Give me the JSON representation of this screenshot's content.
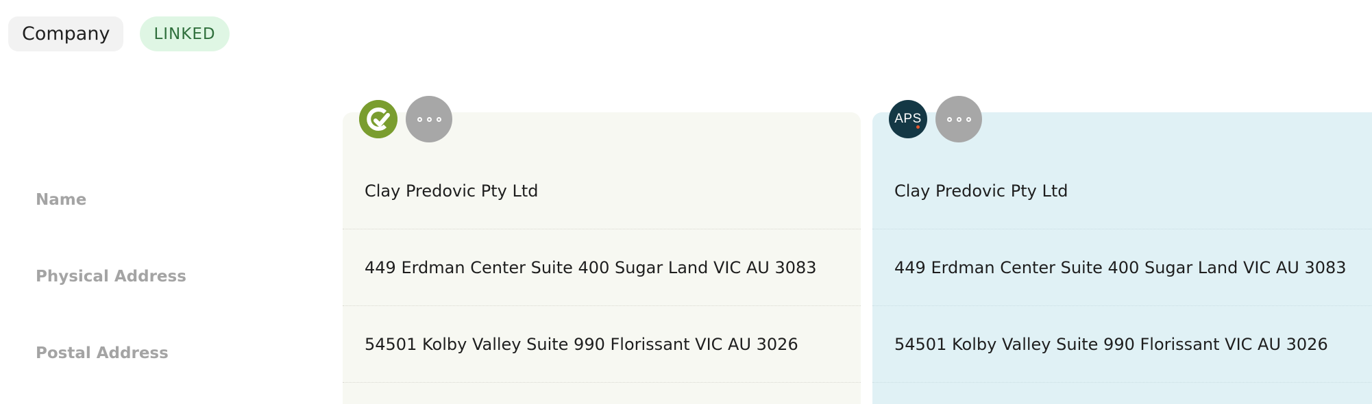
{
  "header": {
    "entity_label": "Company",
    "status_label": "LINKED"
  },
  "rows": {
    "name": "Name",
    "physical_address": "Physical Address",
    "postal_address": "Postal Address"
  },
  "columns": [
    {
      "logo_icon": "clay-predovic-logo-icon",
      "logo_color": "#7a9d2f",
      "background": "#f7f8f2",
      "values": {
        "name": "Clay Predovic Pty Ltd",
        "physical_address": "449 Erdman Center Suite 400 Sugar Land VIC AU 3083",
        "postal_address": "54501 Kolby Valley Suite 990 Florissant VIC AU 3026"
      }
    },
    {
      "logo_icon": "aps-logo-icon",
      "logo_text": "APS",
      "logo_color": "#143845",
      "background": "#e0f1f5",
      "values": {
        "name": "Clay Predovic Pty Ltd",
        "physical_address": "449 Erdman Center Suite 400 Sugar Land VIC AU 3083",
        "postal_address": "54501 Kolby Valley Suite 990 Florissant VIC AU 3026"
      }
    }
  ]
}
